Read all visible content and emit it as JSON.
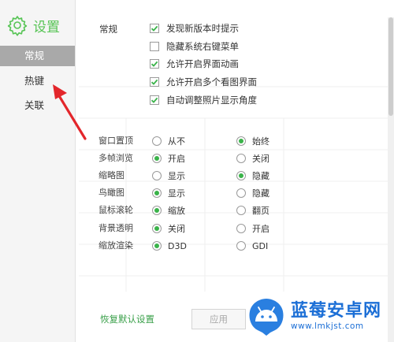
{
  "sidebar": {
    "title": "设置",
    "items": [
      {
        "label": "常规",
        "active": true
      },
      {
        "label": "热键",
        "active": false
      },
      {
        "label": "关联",
        "active": false
      }
    ]
  },
  "general": {
    "section_label": "常规",
    "checkboxes": [
      {
        "label": "发现新版本时提示",
        "checked": true
      },
      {
        "label": "隐藏系统右键菜单",
        "checked": false
      },
      {
        "label": "允许开启界面动画",
        "checked": true
      },
      {
        "label": "允许开启多个看图界面",
        "checked": true
      },
      {
        "label": "自动调整照片显示角度",
        "checked": true
      }
    ],
    "options": [
      {
        "label": "窗口置顶",
        "a": "从不",
        "b": "始终",
        "selected": "b"
      },
      {
        "label": "多帧浏览",
        "a": "开启",
        "b": "关闭",
        "selected": "a"
      },
      {
        "label": "缩略图",
        "a": "显示",
        "b": "隐藏",
        "selected": "b"
      },
      {
        "label": "鸟瞰图",
        "a": "显示",
        "b": "隐藏",
        "selected": "a"
      },
      {
        "label": "鼠标滚轮",
        "a": "缩放",
        "b": "翻页",
        "selected": "a"
      },
      {
        "label": "背景透明",
        "a": "关闭",
        "b": "开启",
        "selected": "a"
      },
      {
        "label": "缩放渲染",
        "a": "D3D",
        "b": "GDI",
        "selected": "a"
      }
    ]
  },
  "footer": {
    "restore_label": "恢复默认设置",
    "apply_label": "应用"
  },
  "watermark": {
    "name": "蓝莓安卓网",
    "url": "www.lmkjst.com"
  },
  "colors": {
    "accent": "#3ab34a",
    "sidebar_active": "#a9a9a9",
    "arrow": "#e3262b",
    "brand": "#1c6fd6"
  }
}
